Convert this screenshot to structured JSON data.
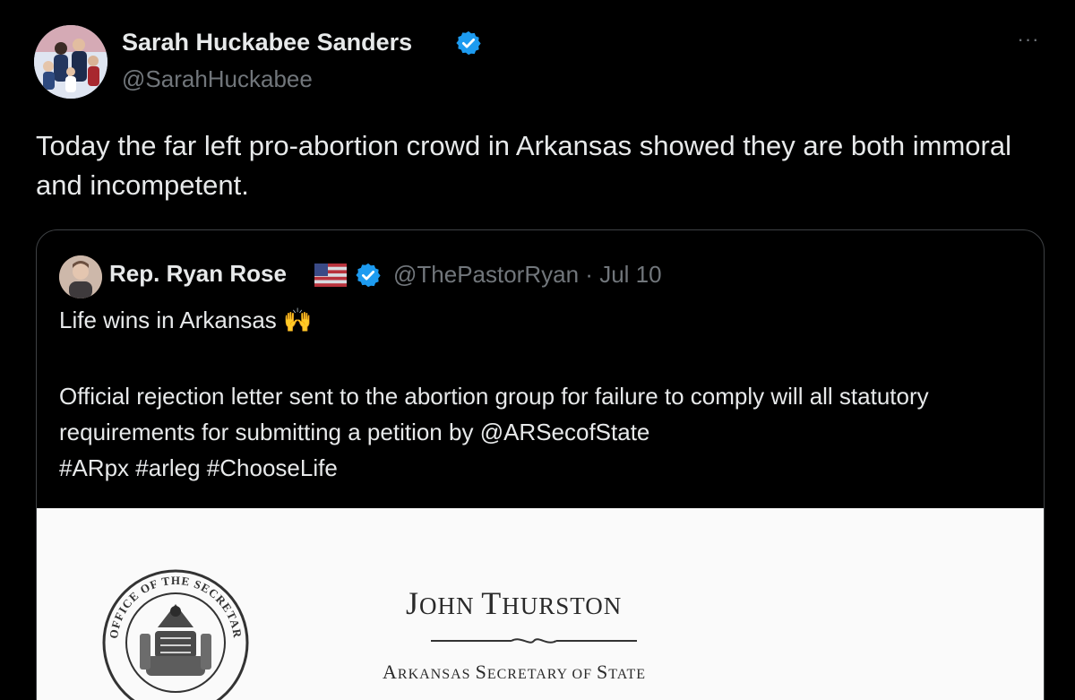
{
  "tweet": {
    "author": {
      "display_name": "Sarah Huckabee Sanders",
      "handle": "@SarahHuckabee",
      "verified": true
    },
    "more_icon": "more-horizontal-icon",
    "more_glyph": "···",
    "text": "Today the far left pro-abortion crowd in Arkansas showed they are both immoral and incompetent."
  },
  "quote": {
    "author": {
      "display_name": "Rep. Ryan Rose",
      "handle": "@ThePastorRyan",
      "separator": "·",
      "date": "Jul 10",
      "flag_icon": "us-flag-icon",
      "verified": true
    },
    "line1": "Life wins in Arkansas",
    "line1_emoji": "🙌",
    "body": {
      "part1": "Official rejection letter sent to the abortion group for failure to comply will all statutory requirements for submitting a petition by ",
      "mention": "@ARSecofState",
      "hashtags": [
        "#ARpx",
        "#arleg",
        "#ChooseLife"
      ]
    }
  },
  "document": {
    "seal_text": "OFFICE OF THE SECRETARY OF STATE",
    "name_initial_1": "J",
    "name_rest_1": "OHN ",
    "name_initial_2": "T",
    "name_rest_2": "HURSTON",
    "title_initial_1": "A",
    "title_rest_1": "RKANSAS ",
    "title_initial_2": "S",
    "title_rest_2": "ECRETARY OF ",
    "title_initial_3": "S",
    "title_rest_3": "TATE"
  },
  "colors": {
    "background": "#000000",
    "text_primary": "#e7e9ea",
    "text_secondary": "#71767b",
    "verified_blue": "#1d9bf0",
    "border": "#3e4144"
  }
}
